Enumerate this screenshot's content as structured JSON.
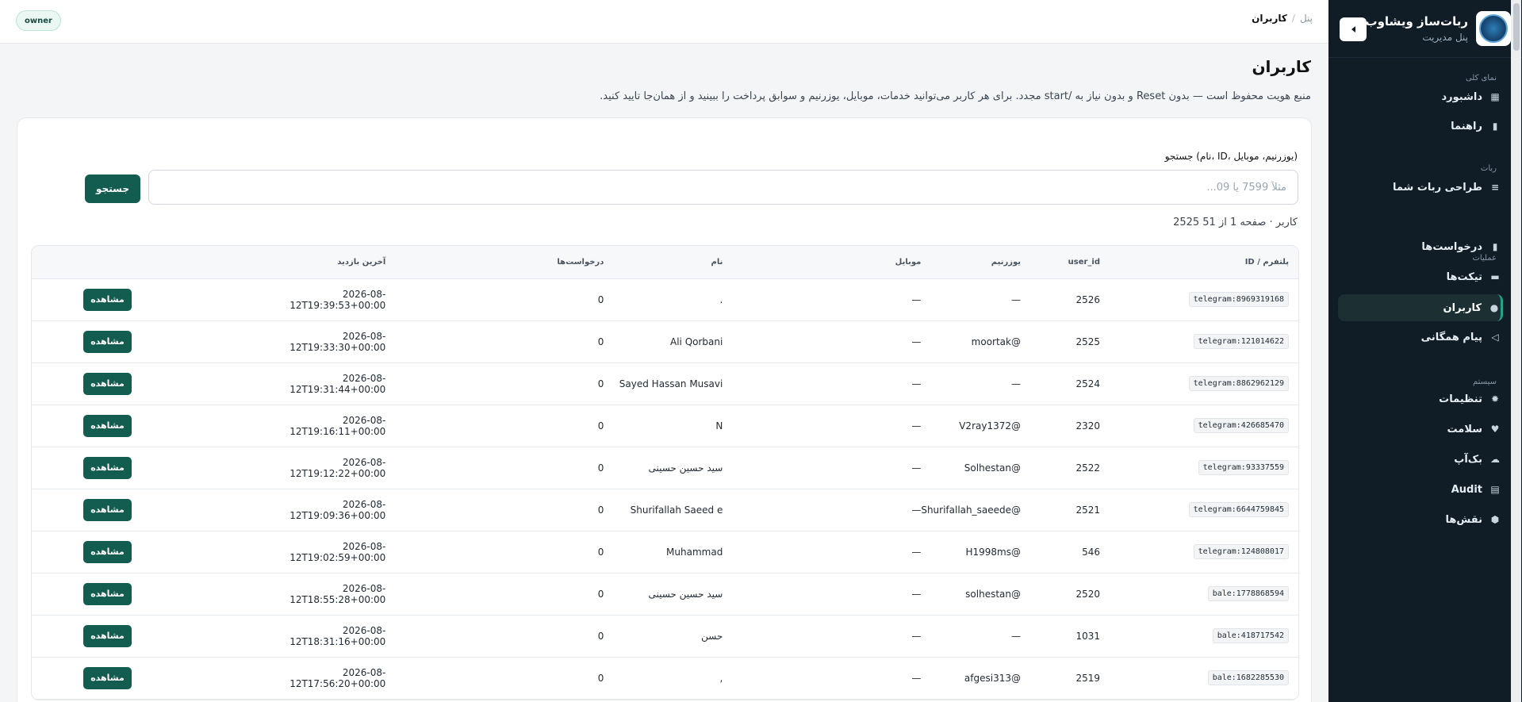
{
  "app": {
    "title": "ربات‌ساز ویشاوب",
    "subtitle": "پنل مدیریت"
  },
  "topbar": {
    "role_badge": "owner",
    "breadcrumb": {
      "root": "پنل",
      "separator": "/",
      "current": "کاربران"
    }
  },
  "sidebar": {
    "sections": [
      {
        "title": "نمای کلی",
        "items": [
          {
            "label": "داشبورد",
            "icon": "dashboard-icon",
            "glyph": "▦"
          },
          {
            "label": "راهنما",
            "icon": "book-icon",
            "glyph": "▮"
          }
        ]
      },
      {
        "title": "ربات",
        "items": [
          {
            "label": "طراحی ربات شما",
            "icon": "lines-icon",
            "glyph": "≡"
          }
        ]
      },
      {
        "title": "عملیات",
        "items": [
          {
            "label": "درخواست‌ها",
            "icon": "bookmark-icon",
            "glyph": "▮"
          },
          {
            "label": "تیکت‌ها",
            "icon": "ticket-icon",
            "glyph": "▬"
          },
          {
            "label": "کاربران",
            "icon": "user-icon",
            "glyph": "●",
            "active": true
          },
          {
            "label": "پیام همگانی",
            "icon": "megaphone-icon",
            "glyph": "◁"
          }
        ]
      },
      {
        "title": "سیستم",
        "items": [
          {
            "label": "تنظیمات",
            "icon": "gear-icon",
            "glyph": "✹"
          },
          {
            "label": "سلامت",
            "icon": "heart-icon",
            "glyph": "♥"
          },
          {
            "label": "بک‌آپ",
            "icon": "cloud-icon",
            "glyph": "☁"
          },
          {
            "label": "Audit",
            "icon": "clipboard-icon",
            "glyph": "▤"
          },
          {
            "label": "نقش‌ها",
            "icon": "shield-icon",
            "glyph": "⬢"
          }
        ]
      }
    ]
  },
  "main": {
    "title": "کاربران",
    "description": "منبع هویت محفوظ است — بدون Reset و بدون نیاز به /start مجدد. برای هر کاربر می‌توانید خدمات، موبایل، یوزرنیم و سوابق پرداخت را ببینید و از همان‌جا تایید کنید.",
    "search": {
      "label": "جستجو (نام، ID، یوزرنیم، موبایل)",
      "placeholder": "مثلاً 7599 یا 09...",
      "value": "",
      "button": "جستجو"
    },
    "count_line": "2525 کاربر · صفحه 1 از 51",
    "table": {
      "headers": [
        "پلتفرم / ID",
        "user_id",
        "یوزرنیم",
        "موبایل",
        "نام",
        "درخواست‌ها",
        "آخرین بازدید",
        ""
      ],
      "action_label": "مشاهده",
      "rows": [
        {
          "platform_id": "telegram:8969319168",
          "user_id": "2526",
          "username": "—",
          "mobile": "—",
          "name": ".",
          "requests": "0",
          "last_seen": "2026-08-12T19:39:53+00:00"
        },
        {
          "platform_id": "telegram:121014622",
          "user_id": "2525",
          "username": "@moortak",
          "mobile": "—",
          "name": "Ali Qorbani",
          "requests": "0",
          "last_seen": "2026-08-12T19:33:30+00:00"
        },
        {
          "platform_id": "telegram:8862962129",
          "user_id": "2524",
          "username": "—",
          "mobile": "—",
          "name": "Sayed Hassan Musavi",
          "requests": "0",
          "last_seen": "2026-08-12T19:31:44+00:00"
        },
        {
          "platform_id": "telegram:426685470",
          "user_id": "2320",
          "username": "@V2ray1372",
          "mobile": "—",
          "name": "N",
          "requests": "0",
          "last_seen": "2026-08-12T19:16:11+00:00"
        },
        {
          "platform_id": "telegram:93337559",
          "user_id": "2522",
          "username": "@Solhestan",
          "mobile": "—",
          "name": "سید حسین حسینی",
          "requests": "0",
          "last_seen": "2026-08-12T19:12:22+00:00"
        },
        {
          "platform_id": "telegram:6644759845",
          "user_id": "2521",
          "username": "@Shurifallah_saeede",
          "mobile": "—",
          "name": "Shurifallah Saeed e",
          "requests": "0",
          "last_seen": "2026-08-12T19:09:36+00:00"
        },
        {
          "platform_id": "telegram:124808017",
          "user_id": "546",
          "username": "@H1998ms",
          "mobile": "—",
          "name": "Muhammad",
          "requests": "0",
          "last_seen": "2026-08-12T19:02:59+00:00"
        },
        {
          "platform_id": "bale:1778868594",
          "user_id": "2520",
          "username": "@solhestan",
          "mobile": "—",
          "name": "سید حسین حسینی",
          "requests": "0",
          "last_seen": "2026-08-12T18:55:28+00:00"
        },
        {
          "platform_id": "bale:418717542",
          "user_id": "1031",
          "username": "—",
          "mobile": "—",
          "name": "حسن",
          "requests": "0",
          "last_seen": "2026-08-12T18:31:16+00:00"
        },
        {
          "platform_id": "bale:1682285530",
          "user_id": "2519",
          "username": "@afgesi313",
          "mobile": "—",
          "name": ",",
          "requests": "0",
          "last_seen": "2026-08-12T17:56:20+00:00"
        }
      ]
    }
  },
  "colors": {
    "sidebar_bg": "#101c26",
    "accent": "#135c50",
    "active_indicator": "#1fa58c"
  }
}
